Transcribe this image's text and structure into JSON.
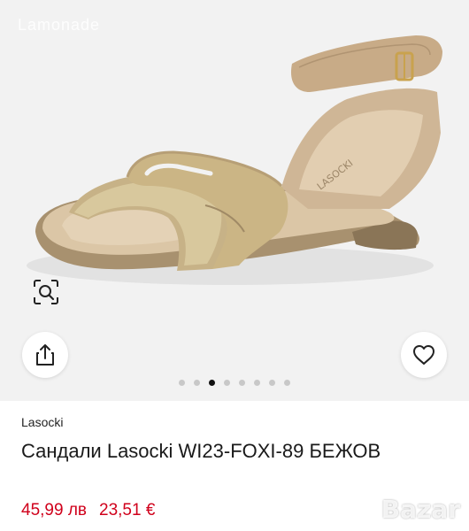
{
  "gallery": {
    "watermark": "Lamonade",
    "dots_total": 8,
    "active_dot": 2,
    "insole_print": "LASOCKI"
  },
  "product": {
    "brand": "Lasocki",
    "title": "Сандали Lasocki WI23-FOXI-89 БЕЖОВ",
    "old_price": "45,99 лв",
    "new_price": "23,51 €"
  },
  "site_watermark": "Bazar",
  "colors": {
    "price": "#d0001b",
    "dot_active": "#111111",
    "dot": "#c8c8c8"
  },
  "icons": {
    "zoom": "zoom-scan-icon",
    "share": "share-icon",
    "favorite": "heart-icon"
  }
}
